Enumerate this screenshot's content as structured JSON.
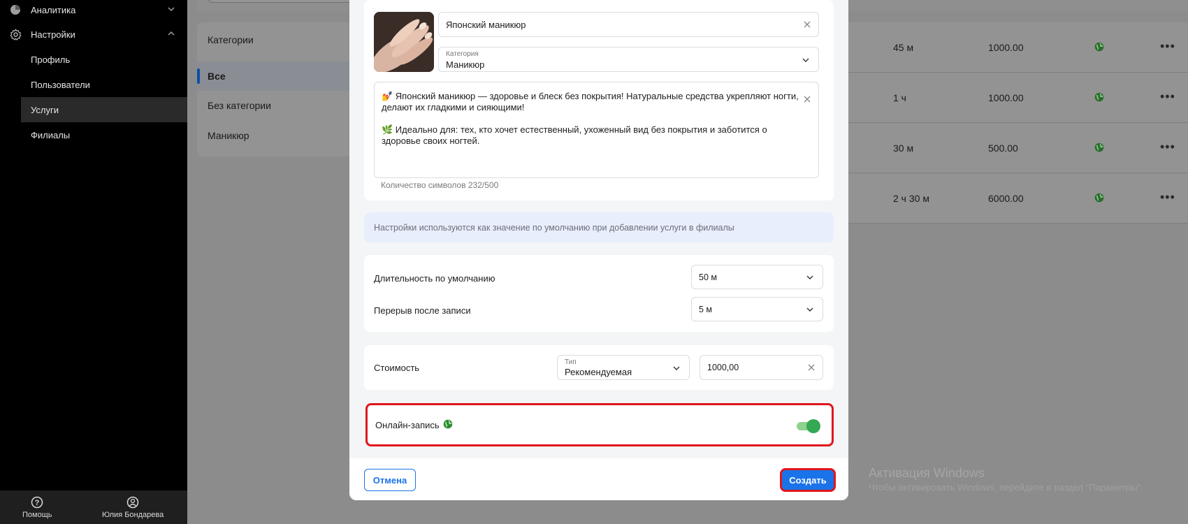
{
  "sidebar": {
    "items": [
      {
        "label": "Аналитика",
        "icon": "pie-chart-icon"
      },
      {
        "label": "Настройки",
        "icon": "gear-icon"
      },
      {
        "label": "Профиль"
      },
      {
        "label": "Пользователи"
      },
      {
        "label": "Услуги"
      },
      {
        "label": "Филиалы"
      }
    ],
    "help_label": "Помощь",
    "user_name": "Юлия Бондарева"
  },
  "categories": {
    "title": "Категории",
    "items": [
      "Все",
      "Без категории",
      "Маникюр"
    ]
  },
  "table": {
    "rows": [
      {
        "duration": "45 м",
        "price": "1000.00"
      },
      {
        "duration": "1 ч",
        "price": "1000.00"
      },
      {
        "duration": "30 м",
        "price": "500.00"
      },
      {
        "duration": "2 ч 30 м",
        "price": "6000.00"
      }
    ]
  },
  "modal": {
    "name_value": "Японский маникюр",
    "category_label": "Категория",
    "category_value": "Маникюр",
    "description_line1": "💅 Японский маникюр — здоровье и блеск без покрытия! Натуральные средства укрепляют ногти, делают их гладкими и сияющими!",
    "description_line2": "🌿 Идеально для: тех, кто хочет естественный, ухоженный вид без покрытия и заботится о здоровье своих ногтей.",
    "char_counter": "Количество символов 232/500",
    "info_text": "Настройки используются как значение по умолчанию при добавлении услуги в филиалы",
    "duration_label": "Длительность по умолчанию",
    "duration_value": "50 м",
    "break_label": "Перерыв после записи",
    "break_value": "5 м",
    "price_label": "Стоимость",
    "price_type_label": "Тип",
    "price_type_value": "Рекомендуемая",
    "price_value": "1000,00",
    "online_label": "Онлайн-запись",
    "online_enabled": true,
    "cancel_label": "Отмена",
    "create_label": "Создать"
  },
  "watermark": {
    "title": "Активация Windows",
    "subtitle": "Чтобы активировать Windows, перейдите в раздел \"Параметры\"."
  },
  "colors": {
    "accent": "#1a73e8",
    "highlight": "#e0161d",
    "toggle_on": "#34a853"
  }
}
